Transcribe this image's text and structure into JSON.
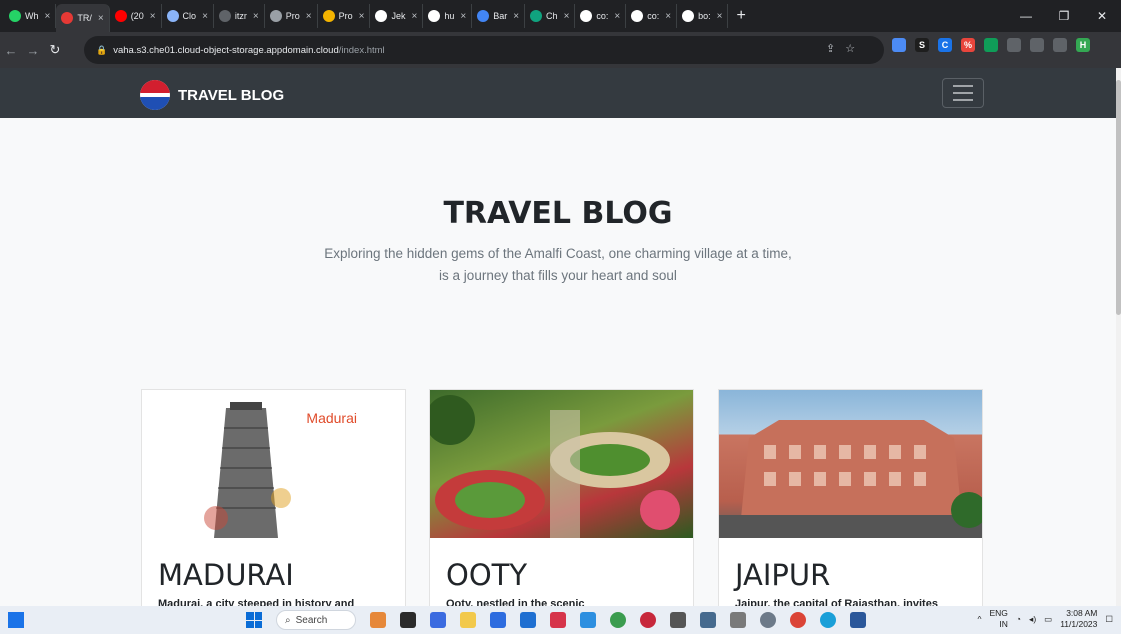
{
  "browser": {
    "tabs": [
      {
        "label": "Wh",
        "color": "#25d366"
      },
      {
        "label": "TR/",
        "color": "#e53935",
        "active": true
      },
      {
        "label": "(20",
        "color": "#ff0000"
      },
      {
        "label": "Clo",
        "color": "#8ab4f8"
      },
      {
        "label": "itzr",
        "color": "#5f6368"
      },
      {
        "label": "Pro",
        "color": "#9aa0a6"
      },
      {
        "label": "Pro",
        "color": "#f4b400"
      },
      {
        "label": "Jek",
        "color": "#ffffff"
      },
      {
        "label": "hu",
        "color": "#ffffff"
      },
      {
        "label": "Bar",
        "color": "#4285f4"
      },
      {
        "label": "Ch",
        "color": "#10a37f"
      },
      {
        "label": "co:",
        "color": "#ffffff"
      },
      {
        "label": "co:",
        "color": "#ffffff"
      },
      {
        "label": "bo:",
        "color": "#ffffff"
      }
    ],
    "url_host": "vaha.s3.che01.cloud-object-storage.appdomain.cloud",
    "url_path": "/index.html",
    "extensions": [
      {
        "label": "",
        "color": "#4c8bf5"
      },
      {
        "label": "S",
        "color": "#1e1e1e"
      },
      {
        "label": "C",
        "color": "#1a73e8"
      },
      {
        "label": "%",
        "color": "#e8453c"
      },
      {
        "label": "",
        "color": "#0f9d58"
      },
      {
        "label": "",
        "color": "#5f6368"
      },
      {
        "label": "",
        "color": "#5f6368"
      },
      {
        "label": "",
        "color": "#5f6368"
      },
      {
        "label": "H",
        "color": "#34a853"
      }
    ]
  },
  "navbar": {
    "brand": "TRAVEL BLOG"
  },
  "hero": {
    "title": "TRAVEL BLOG",
    "subtitle": "Exploring the hidden gems of the Amalfi Coast, one charming village at a time, is a journey that fills your heart and soul"
  },
  "cards": [
    {
      "title": "MADURAI",
      "desc": "Madurai, a city steeped in history and",
      "image_tag": "Madurai"
    },
    {
      "title": "OOTY",
      "desc": "Ooty, nestled in the scenic",
      "image_tag": ""
    },
    {
      "title": "JAIPUR",
      "desc": "Jaipur, the capital of Rajasthan, invites",
      "image_tag": ""
    }
  ],
  "taskbar": {
    "search_label": "Search",
    "lang_top": "ENG",
    "lang_bottom": "IN",
    "time": "3:08 AM",
    "date": "11/1/2023"
  }
}
